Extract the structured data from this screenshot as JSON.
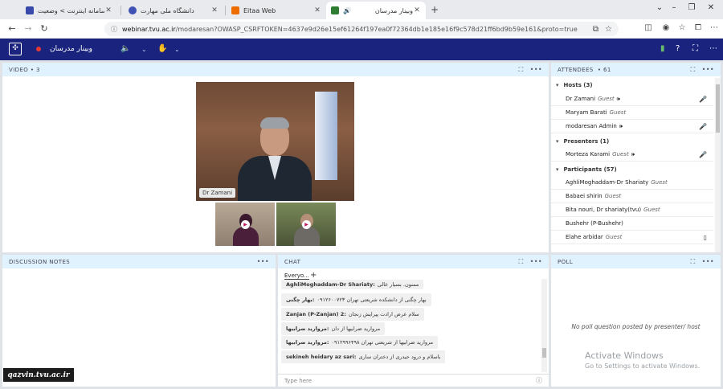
{
  "browser": {
    "tabs": [
      {
        "title": "سامانه اینترنت > وضعیت",
        "icon": "shield-favicon"
      },
      {
        "title": "دانشگاه ملی مهارت",
        "icon": "university-favicon"
      },
      {
        "title": "Eitaa Web",
        "icon": "eitaa-favicon"
      },
      {
        "title": "وبینار مدرسان",
        "icon": "adobe-connect-favicon"
      }
    ],
    "url_host": "webinar.tvu.ac.ir",
    "url_rest": "/modaresan?OWASP_CSRFTOKEN=4637e9d26e15ef61264f197ea0f72364db1e185e16f9c578d21ff6bd9b59e161&proto=true",
    "new_tab": "+"
  },
  "app": {
    "room_name": "وبینار مدرسان",
    "accent": "#1a237e"
  },
  "video": {
    "title": "VIDEO",
    "count_label": "• 3",
    "main_name": "Dr Zamani"
  },
  "attendees": {
    "title": "ATTENDEES",
    "count_label": "• 61",
    "groups": [
      {
        "label": "Hosts (3)"
      },
      {
        "label": "Presenters (1)"
      },
      {
        "label": "Participants (57)"
      }
    ],
    "hosts": [
      {
        "name": "Dr Zamani",
        "role": "Guest"
      },
      {
        "name": "Maryam Barati",
        "role": "Guest"
      },
      {
        "name": "modaresan Admin",
        "role": ""
      }
    ],
    "presenters": [
      {
        "name": "Morteza Karami",
        "role": "Guest"
      }
    ],
    "participants": [
      {
        "name": "AghliMoghaddam-Dr Shariaty",
        "role": "Guest"
      },
      {
        "name": "Babaei shirin",
        "role": "Guest"
      },
      {
        "name": "Bita nouri, Dr shariaty(tvu)",
        "role": "Guest"
      },
      {
        "name": "Bushehr (P-Bushehr)",
        "role": ""
      },
      {
        "name": "Elahe arbidar",
        "role": "Guest"
      }
    ]
  },
  "notes": {
    "title": "DISCUSSION NOTES"
  },
  "chat": {
    "title": "CHAT",
    "tab_label": "Everyo...",
    "add_label": "+",
    "messages": [
      {
        "sender": "AghliMoghaddam-Dr Shariaty:",
        "text": "ممنون. بسیار عالی"
      },
      {
        "sender": "بهار چگنی:",
        "text": "بهار چگنی از دانشکده شریعتی تهران ۰۹۱۲۶۰۰۷۲۳"
      },
      {
        "sender": "Zanjan (P-Zanjan) 2:",
        "text": "سلام عرض ارادت پیرایش زنجان"
      },
      {
        "sender": "مروارید ضرابیها:",
        "text": "مروارید ضرابیها  از دان"
      },
      {
        "sender": "مروارید ضرابیها:",
        "text": "مروارید ضرابیها از شریعتی تهران ۰۹۱۲۹۹۶۴۹۸"
      },
      {
        "sender": "sekineh heidary az sari:",
        "text": "باسلام و درود حیدری از دختران ساری"
      }
    ],
    "input_placeholder": "Type here"
  },
  "poll": {
    "title": "POLL",
    "empty_text": "No poll question posted by presenter/ host"
  },
  "overlay": {
    "watermark": "qazvin.tvu.ac.ir",
    "activate_title": "Activate Windows",
    "activate_sub": "Go to Settings to activate Windows."
  }
}
